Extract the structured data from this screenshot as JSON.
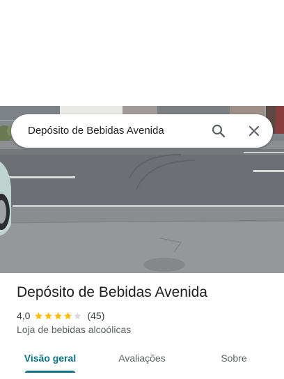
{
  "search": {
    "query": "Depósito de Bebidas Avenida",
    "search_icon": "search-icon",
    "close_icon": "close-icon"
  },
  "place": {
    "name": "Depósito de Bebidas Avenida",
    "rating": "4,0",
    "rating_stars": 4,
    "rating_max": 5,
    "review_count": "(45)",
    "category": "Loja de bebidas alcoólicas"
  },
  "tabs": [
    {
      "label": "Visão geral",
      "active": true
    },
    {
      "label": "Avaliações",
      "active": false
    },
    {
      "label": "Sobre",
      "active": false
    }
  ],
  "colors": {
    "accent": "#0b7285",
    "star_filled": "#fbbc04",
    "star_empty": "#dadce0",
    "text_primary": "#202124",
    "text_secondary": "#5f6368"
  }
}
